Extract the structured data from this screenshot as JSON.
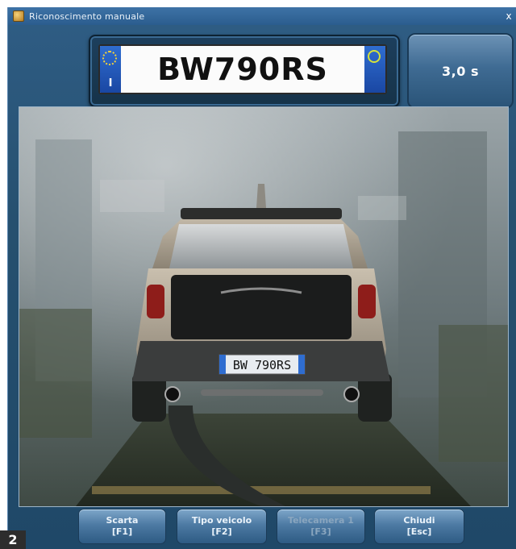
{
  "window": {
    "title": "Riconoscimento manuale",
    "close_glyph": "x"
  },
  "plate": {
    "number": "BW790RS",
    "country_code": "I"
  },
  "timer": {
    "value": "3,0 s"
  },
  "photo": {
    "visible_plate_text": "BW 790RS"
  },
  "buttons": [
    {
      "label": "Scarta",
      "shortcut": "[F1]"
    },
    {
      "label": "Tipo veicolo",
      "shortcut": "[F2]"
    },
    {
      "label": "Telecamera 1",
      "shortcut": "[F3]"
    },
    {
      "label": "Chiudi",
      "shortcut": "[Esc]"
    }
  ],
  "figure_badge": "2",
  "colors": {
    "window_bg": "#26506f",
    "titlebar": "#3e73a6",
    "button": "#4d7aa3",
    "plate_band": "#2f6dd0"
  }
}
